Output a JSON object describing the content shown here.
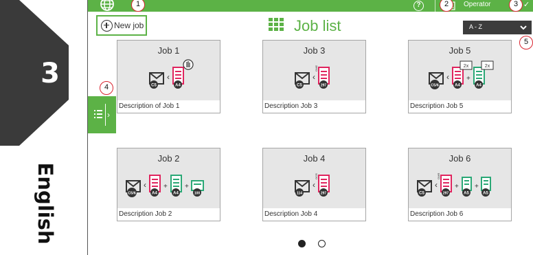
{
  "manual": {
    "chapter_number": "3",
    "language": "English"
  },
  "topbar": {
    "user_label": "Operator"
  },
  "header": {
    "new_job_label": "New job",
    "title": "Job list",
    "sort_value": "A - Z"
  },
  "jobs": [
    {
      "title": "Job 1",
      "description": "Description of Job 1",
      "envelope": "C5",
      "inserts": [
        "A4"
      ],
      "icon_text": []
    },
    {
      "title": "Job 3",
      "description": "Description Job 3",
      "envelope": "C5",
      "inserts": [
        "297"
      ],
      "icon_text": [
        "OME"
      ]
    },
    {
      "title": "Job 5",
      "description": "Description Job 5",
      "envelope": "C5/6",
      "inserts": [
        "A4",
        "A4"
      ],
      "icon_text": [
        "2x",
        "2x"
      ]
    },
    {
      "title": "Job 2",
      "description": "Description Job 2",
      "envelope": "C5/6",
      "inserts": [
        "A4",
        "A4",
        "100"
      ],
      "icon_text": []
    },
    {
      "title": "Job 4",
      "description": "Description Job 4",
      "envelope": "114",
      "inserts": [
        "297"
      ],
      "icon_text": [
        "OCR"
      ]
    },
    {
      "title": "Job 6",
      "description": "Description Job 6",
      "envelope": "C5",
      "inserts": [
        "297",
        "A5",
        "A5"
      ],
      "icon_text": [
        "OMR"
      ]
    }
  ],
  "pagination": {
    "pages": 2,
    "current": 1
  },
  "callouts": [
    "1",
    "2",
    "3",
    "4",
    "5"
  ],
  "colors": {
    "accent_green": "#5cb246",
    "doc_pink": "#e0245e",
    "doc_teal": "#2aa876",
    "callout_red": "#d9232e",
    "sort_bg": "#3c3c3c"
  }
}
